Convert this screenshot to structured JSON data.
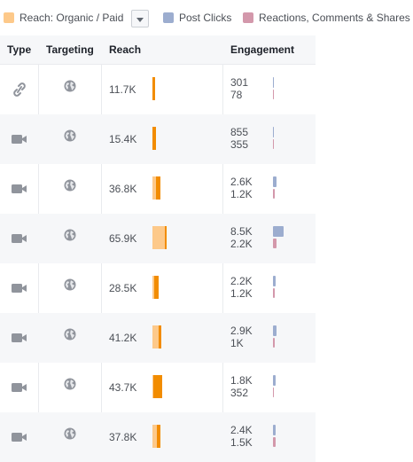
{
  "legend": {
    "reach": {
      "label": "Reach: Organic / Paid",
      "color": "#fdc98a"
    },
    "clicks": {
      "label": "Post Clicks",
      "color": "#9cadcf"
    },
    "reactions": {
      "label": "Reactions, Comments & Shares",
      "color": "#d398ab"
    },
    "dropdown_icon": "chevron-down-icon"
  },
  "headers": {
    "type": "Type",
    "targeting": "Targeting",
    "reach": "Reach",
    "engagement": "Engagement"
  },
  "colors": {
    "organic": "#fdc98a",
    "paid": "#f28c00",
    "clicks": "#9cadcf",
    "reactions": "#d398ab"
  },
  "rows": [
    {
      "type": "link",
      "targeting": "public",
      "reach": "11.7K",
      "clicks": "301",
      "reactions": "78"
    },
    {
      "type": "video",
      "targeting": "public",
      "reach": "15.4K",
      "clicks": "855",
      "reactions": "355"
    },
    {
      "type": "video",
      "targeting": "public",
      "reach": "36.8K",
      "clicks": "2.6K",
      "reactions": "1.2K"
    },
    {
      "type": "video",
      "targeting": "public",
      "reach": "65.9K",
      "clicks": "8.5K",
      "reactions": "2.2K"
    },
    {
      "type": "video",
      "targeting": "public",
      "reach": "28.5K",
      "clicks": "2.2K",
      "reactions": "1.2K"
    },
    {
      "type": "video",
      "targeting": "public",
      "reach": "41.2K",
      "clicks": "2.9K",
      "reactions": "1K"
    },
    {
      "type": "video",
      "targeting": "public",
      "reach": "43.7K",
      "clicks": "1.8K",
      "reactions": "352"
    },
    {
      "type": "video",
      "targeting": "public",
      "reach": "37.8K",
      "clicks": "2.4K",
      "reactions": "1.5K"
    }
  ]
}
